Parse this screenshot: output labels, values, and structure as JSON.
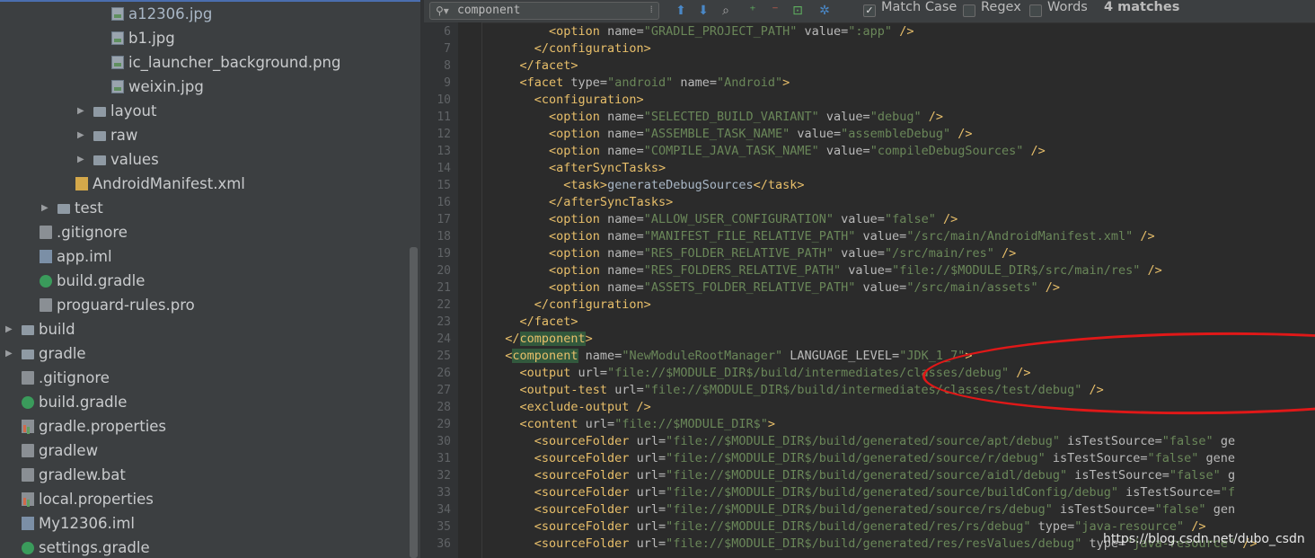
{
  "project_tree": {
    "items": [
      {
        "label": "a12306.jpg",
        "icon": "image-file-icon",
        "indent": 146,
        "arrow": false,
        "selected": true
      },
      {
        "label": "b1.jpg",
        "icon": "image-file-icon",
        "indent": 146,
        "arrow": false
      },
      {
        "label": "ic_launcher_background.png",
        "icon": "image-file-icon",
        "indent": 146,
        "arrow": false
      },
      {
        "label": "weixin.jpg",
        "icon": "image-file-icon",
        "indent": 146,
        "arrow": false
      },
      {
        "label": "layout",
        "icon": "folder-icon",
        "indent": 126,
        "arrow": true
      },
      {
        "label": "raw",
        "icon": "folder-icon",
        "indent": 126,
        "arrow": true
      },
      {
        "label": "values",
        "icon": "folder-icon",
        "indent": 126,
        "arrow": true
      },
      {
        "label": "AndroidManifest.xml",
        "icon": "xml-manifest-icon",
        "indent": 106,
        "arrow": false
      },
      {
        "label": "test",
        "icon": "folder-icon",
        "indent": 86,
        "arrow": true
      },
      {
        "label": ".gitignore",
        "icon": "file-icon",
        "indent": 66,
        "arrow": false
      },
      {
        "label": "app.iml",
        "icon": "module-file-icon",
        "indent": 66,
        "arrow": false
      },
      {
        "label": "build.gradle",
        "icon": "gradle-icon",
        "indent": 66,
        "arrow": false
      },
      {
        "label": "proguard-rules.pro",
        "icon": "file-icon",
        "indent": 66,
        "arrow": false
      },
      {
        "label": "build",
        "icon": "folder-icon",
        "indent": 46,
        "arrow": true
      },
      {
        "label": "gradle",
        "icon": "folder-icon",
        "indent": 46,
        "arrow": true
      },
      {
        "label": ".gitignore",
        "icon": "file-icon",
        "indent": 46,
        "arrow": false
      },
      {
        "label": "build.gradle",
        "icon": "gradle-icon",
        "indent": 46,
        "arrow": false
      },
      {
        "label": "gradle.properties",
        "icon": "properties-file-icon",
        "indent": 46,
        "arrow": false
      },
      {
        "label": "gradlew",
        "icon": "file-icon",
        "indent": 46,
        "arrow": false
      },
      {
        "label": "gradlew.bat",
        "icon": "file-icon",
        "indent": 46,
        "arrow": false
      },
      {
        "label": "local.properties",
        "icon": "properties-file-icon",
        "indent": 46,
        "arrow": false
      },
      {
        "label": "My12306.iml",
        "icon": "module-file-icon",
        "indent": 46,
        "arrow": false
      },
      {
        "label": "settings.gradle",
        "icon": "gradle-icon",
        "indent": 46,
        "arrow": false
      }
    ]
  },
  "search_bar": {
    "query": "component",
    "match_case_label": "Match Case",
    "match_case_checked": true,
    "regex_label": "Regex",
    "regex_checked": false,
    "words_label": "Words",
    "words_checked": false,
    "match_count": "4 matches"
  },
  "editor": {
    "lines": [
      {
        "n": "6",
        "indent": 8,
        "tokens": [
          [
            "t",
            "<option "
          ],
          [
            "a",
            "name="
          ],
          [
            "v",
            "\"GRADLE_PROJECT_PATH\""
          ],
          [
            "a",
            " value="
          ],
          [
            "v",
            "\":app\""
          ],
          [
            "t",
            " />"
          ]
        ]
      },
      {
        "n": "7",
        "indent": 6,
        "tokens": [
          [
            "t",
            "</configuration>"
          ]
        ]
      },
      {
        "n": "8",
        "indent": 4,
        "tokens": [
          [
            "t",
            "</facet>"
          ]
        ]
      },
      {
        "n": "9",
        "indent": 4,
        "tokens": [
          [
            "t",
            "<facet "
          ],
          [
            "a",
            "type="
          ],
          [
            "v",
            "\"android\""
          ],
          [
            "a",
            " name="
          ],
          [
            "v",
            "\"Android\""
          ],
          [
            "t",
            ">"
          ]
        ]
      },
      {
        "n": "10",
        "indent": 6,
        "tokens": [
          [
            "t",
            "<configuration>"
          ]
        ]
      },
      {
        "n": "11",
        "indent": 8,
        "tokens": [
          [
            "t",
            "<option "
          ],
          [
            "a",
            "name="
          ],
          [
            "v",
            "\"SELECTED_BUILD_VARIANT\""
          ],
          [
            "a",
            " value="
          ],
          [
            "v",
            "\"debug\""
          ],
          [
            "t",
            " />"
          ]
        ]
      },
      {
        "n": "12",
        "indent": 8,
        "tokens": [
          [
            "t",
            "<option "
          ],
          [
            "a",
            "name="
          ],
          [
            "v",
            "\"ASSEMBLE_TASK_NAME\""
          ],
          [
            "a",
            " value="
          ],
          [
            "v",
            "\"assembleDebug\""
          ],
          [
            "t",
            " />"
          ]
        ]
      },
      {
        "n": "13",
        "indent": 8,
        "tokens": [
          [
            "t",
            "<option "
          ],
          [
            "a",
            "name="
          ],
          [
            "v",
            "\"COMPILE_JAVA_TASK_NAME\""
          ],
          [
            "a",
            " value="
          ],
          [
            "v",
            "\"compileDebugSources\""
          ],
          [
            "t",
            " />"
          ]
        ]
      },
      {
        "n": "14",
        "indent": 8,
        "tokens": [
          [
            "t",
            "<afterSyncTasks>"
          ]
        ]
      },
      {
        "n": "15",
        "indent": 10,
        "tokens": [
          [
            "t",
            "<task>"
          ],
          [
            "x",
            "generateDebugSources"
          ],
          [
            "t",
            "</task>"
          ]
        ]
      },
      {
        "n": "16",
        "indent": 8,
        "tokens": [
          [
            "t",
            "</afterSyncTasks>"
          ]
        ]
      },
      {
        "n": "17",
        "indent": 8,
        "tokens": [
          [
            "t",
            "<option "
          ],
          [
            "a",
            "name="
          ],
          [
            "v",
            "\"ALLOW_USER_CONFIGURATION\""
          ],
          [
            "a",
            " value="
          ],
          [
            "v",
            "\"false\""
          ],
          [
            "t",
            " />"
          ]
        ]
      },
      {
        "n": "18",
        "indent": 8,
        "tokens": [
          [
            "t",
            "<option "
          ],
          [
            "a",
            "name="
          ],
          [
            "v",
            "\"MANIFEST_FILE_RELATIVE_PATH\""
          ],
          [
            "a",
            " value="
          ],
          [
            "v",
            "\"/src/main/AndroidManifest.xml\""
          ],
          [
            "t",
            " />"
          ]
        ]
      },
      {
        "n": "19",
        "indent": 8,
        "tokens": [
          [
            "t",
            "<option "
          ],
          [
            "a",
            "name="
          ],
          [
            "v",
            "\"RES_FOLDER_RELATIVE_PATH\""
          ],
          [
            "a",
            " value="
          ],
          [
            "v",
            "\"/src/main/res\""
          ],
          [
            "t",
            " />"
          ]
        ]
      },
      {
        "n": "20",
        "indent": 8,
        "tokens": [
          [
            "t",
            "<option "
          ],
          [
            "a",
            "name="
          ],
          [
            "v",
            "\"RES_FOLDERS_RELATIVE_PATH\""
          ],
          [
            "a",
            " value="
          ],
          [
            "v",
            "\"file://$MODULE_DIR$/src/main/res\""
          ],
          [
            "t",
            " />"
          ]
        ]
      },
      {
        "n": "21",
        "indent": 8,
        "tokens": [
          [
            "t",
            "<option "
          ],
          [
            "a",
            "name="
          ],
          [
            "v",
            "\"ASSETS_FOLDER_RELATIVE_PATH\""
          ],
          [
            "a",
            " value="
          ],
          [
            "v",
            "\"/src/main/assets\""
          ],
          [
            "t",
            " />"
          ]
        ]
      },
      {
        "n": "22",
        "indent": 6,
        "tokens": [
          [
            "t",
            "</configuration>"
          ]
        ]
      },
      {
        "n": "23",
        "indent": 4,
        "tokens": [
          [
            "t",
            "</facet>"
          ]
        ]
      },
      {
        "n": "24",
        "indent": 2,
        "tokens": [
          [
            "t",
            "</"
          ],
          [
            "th",
            "component"
          ],
          [
            "t",
            ">"
          ]
        ]
      },
      {
        "n": "25",
        "indent": 2,
        "tokens": [
          [
            "t",
            "<"
          ],
          [
            "th",
            "component"
          ],
          [
            "a",
            " name="
          ],
          [
            "v",
            "\"NewModuleRootManager\""
          ],
          [
            "a",
            " LANGUAGE_LEVEL="
          ],
          [
            "v",
            "\"JDK_1_7\""
          ],
          [
            "t",
            ">"
          ]
        ]
      },
      {
        "n": "26",
        "indent": 4,
        "tokens": [
          [
            "t",
            "<output "
          ],
          [
            "a",
            "url="
          ],
          [
            "v",
            "\"file://$MODULE_DIR$/build/intermediates/classes/debug\""
          ],
          [
            "t",
            " />"
          ]
        ]
      },
      {
        "n": "27",
        "indent": 4,
        "tokens": [
          [
            "t",
            "<output-test "
          ],
          [
            "a",
            "url="
          ],
          [
            "v",
            "\"file://$MODULE_DIR$/build/intermediates/classes/test/debug\""
          ],
          [
            "t",
            " />"
          ]
        ]
      },
      {
        "n": "28",
        "indent": 4,
        "tokens": [
          [
            "t",
            "<exclude-output />"
          ]
        ]
      },
      {
        "n": "29",
        "indent": 4,
        "tokens": [
          [
            "t",
            "<content "
          ],
          [
            "a",
            "url="
          ],
          [
            "v",
            "\"file://$MODULE_DIR$\""
          ],
          [
            "t",
            ">"
          ]
        ]
      },
      {
        "n": "30",
        "indent": 6,
        "tokens": [
          [
            "t",
            "<sourceFolder "
          ],
          [
            "a",
            "url="
          ],
          [
            "v",
            "\"file://$MODULE_DIR$/build/generated/source/apt/debug\""
          ],
          [
            "a",
            " isTestSource="
          ],
          [
            "v",
            "\"false\""
          ],
          [
            "a",
            " ge"
          ]
        ]
      },
      {
        "n": "31",
        "indent": 6,
        "tokens": [
          [
            "t",
            "<sourceFolder "
          ],
          [
            "a",
            "url="
          ],
          [
            "v",
            "\"file://$MODULE_DIR$/build/generated/source/r/debug\""
          ],
          [
            "a",
            " isTestSource="
          ],
          [
            "v",
            "\"false\""
          ],
          [
            "a",
            " gene"
          ]
        ]
      },
      {
        "n": "32",
        "indent": 6,
        "tokens": [
          [
            "t",
            "<sourceFolder "
          ],
          [
            "a",
            "url="
          ],
          [
            "v",
            "\"file://$MODULE_DIR$/build/generated/source/aidl/debug\""
          ],
          [
            "a",
            " isTestSource="
          ],
          [
            "v",
            "\"false\""
          ],
          [
            "a",
            " g"
          ]
        ]
      },
      {
        "n": "33",
        "indent": 6,
        "tokens": [
          [
            "t",
            "<sourceFolder "
          ],
          [
            "a",
            "url="
          ],
          [
            "v",
            "\"file://$MODULE_DIR$/build/generated/source/buildConfig/debug\""
          ],
          [
            "a",
            " isTestSource="
          ],
          [
            "v",
            "\"f"
          ]
        ]
      },
      {
        "n": "34",
        "indent": 6,
        "tokens": [
          [
            "t",
            "<sourceFolder "
          ],
          [
            "a",
            "url="
          ],
          [
            "v",
            "\"file://$MODULE_DIR$/build/generated/source/rs/debug\""
          ],
          [
            "a",
            " isTestSource="
          ],
          [
            "v",
            "\"false\""
          ],
          [
            "a",
            " gen"
          ]
        ]
      },
      {
        "n": "35",
        "indent": 6,
        "tokens": [
          [
            "t",
            "<sourceFolder "
          ],
          [
            "a",
            "url="
          ],
          [
            "v",
            "\"file://$MODULE_DIR$/build/generated/res/rs/debug\""
          ],
          [
            "a",
            " type="
          ],
          [
            "v",
            "\"java-resource\""
          ],
          [
            "t",
            " />"
          ]
        ]
      },
      {
        "n": "36",
        "indent": 6,
        "tokens": [
          [
            "t",
            "<sourceFolder "
          ],
          [
            "a",
            "url="
          ],
          [
            "v",
            "\"file://$MODULE_DIR$/build/generated/res/resValues/debug\""
          ],
          [
            "a",
            " type="
          ],
          [
            "v",
            "\"java-resource\""
          ],
          [
            "t",
            " />"
          ]
        ]
      }
    ]
  },
  "watermark": "https://blog.csdn.net/dubo_csdn",
  "colors": {
    "tag": "#e8bf6a",
    "attr": "#bababa",
    "value": "#6a8759",
    "highlight": "#32593d",
    "annotation": "#e01818"
  }
}
